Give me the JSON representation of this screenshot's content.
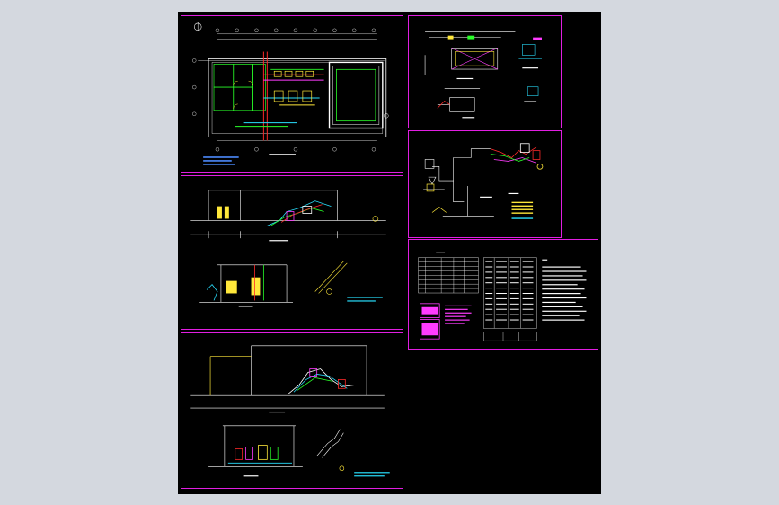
{
  "viewer": {
    "background_color": "#d4d8df",
    "drawing_background": "#000000",
    "frame_color": "#e11ee1"
  },
  "sheets": [
    {
      "id": "plan",
      "kind": "floor-plan"
    },
    {
      "id": "section-a",
      "kind": "section-views"
    },
    {
      "id": "section-b",
      "kind": "section-views"
    },
    {
      "id": "detail-pit",
      "kind": "detail-drawing"
    },
    {
      "id": "process-flow",
      "kind": "process-diagram"
    },
    {
      "id": "tables-notes",
      "kind": "tables-and-notes"
    }
  ],
  "line_colors": {
    "wall": "#ffffff",
    "dimension": "#ffffff",
    "pipe_red": "#ff2a2a",
    "pipe_green": "#29ff29",
    "pipe_cyan": "#29e0ff",
    "equipment_yellow": "#ffe83a",
    "highlight_magenta": "#ff3cff",
    "annotation_blue": "#4d8cff"
  }
}
